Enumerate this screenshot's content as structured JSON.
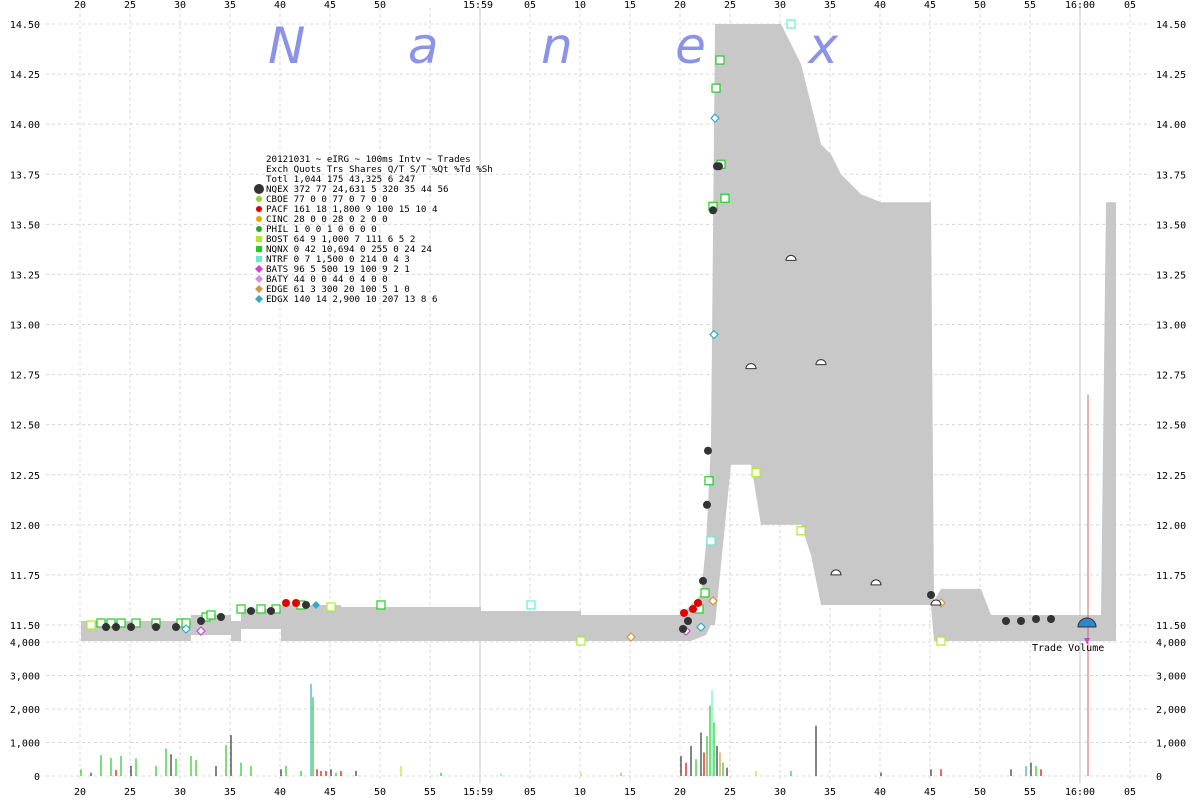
{
  "watermark": "N a n e x",
  "legend": {
    "title": "20121031 ~ eIRG ~ 100ms Intv ~ Trades",
    "header": "Exch Quots Trs Shares  Q/T   S/T  %Qt %Td %Sh",
    "total": "Totl 1,044 175 43,325   6   247",
    "rows": [
      {
        "ex": "NQEX",
        "text": "NQEX   372  77 24,631   5   320  35  44  56",
        "color": "#333333",
        "shape": "circle",
        "big": true
      },
      {
        "ex": "CBOE",
        "text": "CBOE    77   0      0  77     0   7   0   0",
        "color": "#9acd32",
        "shape": "circle"
      },
      {
        "ex": "PACF",
        "text": "PACF   161  18  1,800   9   100  15  10   4",
        "color": "#e00000",
        "shape": "circle"
      },
      {
        "ex": "CINC",
        "text": "CINC    28   0      0  28     0   2   0   0",
        "color": "#f0a000",
        "shape": "circle"
      },
      {
        "ex": "PHIL",
        "text": "PHIL     1   0      0   1     0   0   0   0",
        "color": "#22aa22",
        "shape": "circle"
      },
      {
        "ex": "BOST",
        "text": "BOST    64   9  1,000   7   111   6   5   2",
        "color": "#aaee22",
        "shape": "square"
      },
      {
        "ex": "NQNX",
        "text": "NQNX     0  42 10,694   0   255   0  24  24",
        "color": "#22cc22",
        "shape": "square"
      },
      {
        "ex": "NTRF",
        "text": "NTRF     0   7  1,500   0   214   0   4   3",
        "color": "#66eecc",
        "shape": "square"
      },
      {
        "ex": "BATS",
        "text": "BATS    96   5    500  19   100   9   2   1",
        "color": "#cc44cc",
        "shape": "diamond"
      },
      {
        "ex": "BATY",
        "text": "BATY    44   0      0  44     0   4   0   0",
        "color": "#dd88ee",
        "shape": "diamond"
      },
      {
        "ex": "EDGE",
        "text": "EDGE    61   3    300  20   100   5   1   0",
        "color": "#cc9944",
        "shape": "diamond"
      },
      {
        "ex": "EDGX",
        "text": "EDGX   140  14  2,900  10   207  13   8   6",
        "color": "#33aacc",
        "shape": "diamond"
      }
    ]
  },
  "annotation": "Trade Volume",
  "chart_data": {
    "type": "line",
    "x_ticks_top": [
      "20",
      "25",
      "30",
      "35",
      "40",
      "45",
      "50",
      "15:59",
      "05",
      "10",
      "15",
      "20",
      "25",
      "30",
      "35",
      "40",
      "45",
      "50",
      "55",
      "16:00",
      "05"
    ],
    "x_ticks_bottom": [
      "20",
      "25",
      "30",
      "35",
      "40",
      "45",
      "50",
      "55",
      "15:59",
      "05",
      "10",
      "15",
      "20",
      "25",
      "30",
      "35",
      "40",
      "45",
      "50",
      "55",
      "16:00",
      "05"
    ],
    "price_ticks": [
      "14.50",
      "14.25",
      "14.00",
      "13.75",
      "13.50",
      "13.25",
      "13.00",
      "12.75",
      "12.50",
      "12.25",
      "12.00",
      "11.75",
      "11.50"
    ],
    "volume_ticks_right": [
      "4,000",
      "3,000",
      "2,000",
      "1,000",
      "0"
    ],
    "volume_ticks_left": [
      "4,000",
      "3,000",
      "2,000",
      "1,000",
      "0"
    ],
    "price_ylim": [
      11.5,
      14.5
    ],
    "volume_ylim": [
      0,
      4000
    ],
    "x_range_seconds": [
      -40,
      65
    ],
    "nbbo_band": [
      {
        "t": -40,
        "lo": 11.42,
        "hi": 11.52
      },
      {
        "t": -29,
        "lo": 11.42,
        "hi": 11.52
      },
      {
        "t": -29,
        "lo": 11.45,
        "hi": 11.55
      },
      {
        "t": -25,
        "lo": 11.45,
        "hi": 11.55
      },
      {
        "t": -25,
        "lo": 11.42,
        "hi": 11.52
      },
      {
        "t": -24,
        "lo": 11.42,
        "hi": 11.52
      },
      {
        "t": -24,
        "lo": 11.48,
        "hi": 11.58
      },
      {
        "t": -20,
        "lo": 11.48,
        "hi": 11.58
      },
      {
        "t": -20,
        "lo": 11.42,
        "hi": 11.6
      },
      {
        "t": -14,
        "lo": 11.42,
        "hi": 11.6
      },
      {
        "t": -14,
        "lo": 11.42,
        "hi": 11.59
      },
      {
        "t": 0,
        "lo": 11.42,
        "hi": 11.59
      },
      {
        "t": 0,
        "lo": 11.42,
        "hi": 11.57
      },
      {
        "t": 10,
        "lo": 11.42,
        "hi": 11.57
      },
      {
        "t": 10,
        "lo": 11.42,
        "hi": 11.55
      },
      {
        "t": 20,
        "lo": 11.42,
        "hi": 11.55
      },
      {
        "t": 21,
        "lo": 11.42,
        "hi": 11.6
      },
      {
        "t": 22,
        "lo": 11.44,
        "hi": 11.65
      },
      {
        "t": 22.5,
        "lo": 11.45,
        "hi": 11.9
      },
      {
        "t": 23,
        "lo": 11.5,
        "hi": 12.4
      },
      {
        "t": 23.4,
        "lo": 11.5,
        "hi": 14.5
      },
      {
        "t": 24,
        "lo": 11.8,
        "hi": 14.5
      },
      {
        "t": 25,
        "lo": 12.3,
        "hi": 14.5
      },
      {
        "t": 27,
        "lo": 12.3,
        "hi": 14.5
      },
      {
        "t": 28,
        "lo": 12.0,
        "hi": 14.5
      },
      {
        "t": 30,
        "lo": 12.0,
        "hi": 14.5
      },
      {
        "t": 31,
        "lo": 12.0,
        "hi": 14.4
      },
      {
        "t": 32,
        "lo": 12.0,
        "hi": 14.3
      },
      {
        "t": 33,
        "lo": 11.85,
        "hi": 14.1
      },
      {
        "t": 34,
        "lo": 11.6,
        "hi": 13.9
      },
      {
        "t": 35,
        "lo": 11.6,
        "hi": 13.85
      },
      {
        "t": 36,
        "lo": 11.6,
        "hi": 13.75
      },
      {
        "t": 37,
        "lo": 11.6,
        "hi": 13.7
      },
      {
        "t": 38,
        "lo": 11.6,
        "hi": 13.65
      },
      {
        "t": 40,
        "lo": 11.6,
        "hi": 13.61
      },
      {
        "t": 45,
        "lo": 11.6,
        "hi": 13.61
      },
      {
        "t": 45.3,
        "lo": 11.42,
        "hi": 11.62
      },
      {
        "t": 46,
        "lo": 11.42,
        "hi": 11.68
      },
      {
        "t": 50,
        "lo": 11.42,
        "hi": 11.68
      },
      {
        "t": 51,
        "lo": 11.42,
        "hi": 11.55
      },
      {
        "t": 57,
        "lo": 11.42,
        "hi": 11.55
      },
      {
        "t": 59,
        "lo": 11.42,
        "hi": 11.55
      },
      {
        "t": 62,
        "lo": 11.42,
        "hi": 11.55
      },
      {
        "t": 62.5,
        "lo": 11.42,
        "hi": 13.61
      },
      {
        "t": 63.5,
        "lo": 11.42,
        "hi": 13.61
      }
    ],
    "trades": [
      {
        "t": -37.5,
        "p": 11.49,
        "ex": "NQEX"
      },
      {
        "t": -36.5,
        "p": 11.49,
        "ex": "NQEX"
      },
      {
        "t": -35,
        "p": 11.49,
        "ex": "NQEX"
      },
      {
        "t": -32.5,
        "p": 11.49,
        "ex": "NQEX"
      },
      {
        "t": -30.5,
        "p": 11.49,
        "ex": "NQEX"
      },
      {
        "t": -28,
        "p": 11.52,
        "ex": "NQEX"
      },
      {
        "t": -26,
        "p": 11.54,
        "ex": "NQEX"
      },
      {
        "t": -23,
        "p": 11.57,
        "ex": "NQEX"
      },
      {
        "t": -21,
        "p": 11.57,
        "ex": "NQEX"
      },
      {
        "t": -19.5,
        "p": 11.61,
        "ex": "PACF"
      },
      {
        "t": -18.5,
        "p": 11.61,
        "ex": "PACF"
      },
      {
        "t": -17.5,
        "p": 11.6,
        "ex": "NQEX"
      },
      {
        "t": -16.5,
        "p": 11.6,
        "ex": "EDGX"
      },
      {
        "t": 20.2,
        "p": 11.48,
        "ex": "NQEX"
      },
      {
        "t": 20.7,
        "p": 11.52,
        "ex": "NQEX"
      },
      {
        "t": 20.3,
        "p": 11.56,
        "ex": "PACF"
      },
      {
        "t": 21.2,
        "p": 11.58,
        "ex": "PACF"
      },
      {
        "t": 21.7,
        "p": 11.61,
        "ex": "PACF"
      },
      {
        "t": 22.2,
        "p": 11.72,
        "ex": "NQEX"
      },
      {
        "t": 22.6,
        "p": 12.1,
        "ex": "NQEX"
      },
      {
        "t": 22.7,
        "p": 12.37,
        "ex": "NQEX"
      },
      {
        "t": 23.6,
        "p": 13.79,
        "ex": "NQEX"
      },
      {
        "t": 23.8,
        "p": 13.79,
        "ex": "NQEX"
      },
      {
        "t": 23.2,
        "p": 13.57,
        "ex": "NQEX"
      },
      {
        "t": 45,
        "p": 11.65,
        "ex": "NQEX"
      },
      {
        "t": 52.5,
        "p": 11.52,
        "ex": "NQEX"
      },
      {
        "t": 54,
        "p": 11.52,
        "ex": "NQEX"
      },
      {
        "t": 55.5,
        "p": 11.53,
        "ex": "NQEX"
      },
      {
        "t": 57,
        "p": 11.53,
        "ex": "NQEX"
      }
    ],
    "quotes": [
      {
        "t": -39,
        "p": 11.5,
        "ex": "BOST"
      },
      {
        "t": -38,
        "p": 11.51,
        "ex": "NQNX"
      },
      {
        "t": -37,
        "p": 11.51,
        "ex": "NQNX"
      },
      {
        "t": -36,
        "p": 11.51,
        "ex": "NQNX"
      },
      {
        "t": -34.5,
        "p": 11.51,
        "ex": "NQNX"
      },
      {
        "t": -32.5,
        "p": 11.51,
        "ex": "NQNX"
      },
      {
        "t": -30,
        "p": 11.51,
        "ex": "NQNX"
      },
      {
        "t": -29.5,
        "p": 11.51,
        "ex": "NQNX"
      },
      {
        "t": -27.5,
        "p": 11.54,
        "ex": "NQNX"
      },
      {
        "t": -27,
        "p": 11.55,
        "ex": "NQNX"
      },
      {
        "t": -24,
        "p": 11.58,
        "ex": "NQNX"
      },
      {
        "t": -22,
        "p": 11.58,
        "ex": "NQNX"
      },
      {
        "t": -20.5,
        "p": 11.58,
        "ex": "NQNX"
      },
      {
        "t": -18,
        "p": 11.6,
        "ex": "NQNX"
      },
      {
        "t": -15,
        "p": 11.59,
        "ex": "BOST"
      },
      {
        "t": -10,
        "p": 11.6,
        "ex": "NQNX"
      },
      {
        "t": 5,
        "p": 11.6,
        "ex": "NTRF"
      },
      {
        "t": 21.8,
        "p": 11.58,
        "ex": "NQNX"
      },
      {
        "t": 22.4,
        "p": 11.66,
        "ex": "NQNX"
      },
      {
        "t": 22.8,
        "p": 12.22,
        "ex": "NQNX"
      },
      {
        "t": 23.0,
        "p": 11.92,
        "ex": "NTRF"
      },
      {
        "t": 23.2,
        "p": 13.59,
        "ex": "NQNX"
      },
      {
        "t": 23.5,
        "p": 14.18,
        "ex": "NQNX"
      },
      {
        "t": 23.9,
        "p": 14.32,
        "ex": "NQNX"
      },
      {
        "t": 24.0,
        "p": 13.8,
        "ex": "NQNX"
      },
      {
        "t": 24.4,
        "p": 13.63,
        "ex": "NQNX"
      },
      {
        "t": 27.5,
        "p": 12.26,
        "ex": "BOST"
      },
      {
        "t": 31,
        "p": 14.5,
        "ex": "NTRF"
      },
      {
        "t": 32,
        "p": 11.97,
        "ex": "BOST"
      },
      {
        "t": 46,
        "p": 11.42,
        "ex": "BOST"
      },
      {
        "t": 10,
        "p": 11.42,
        "ex": "BOST"
      },
      {
        "t": 15,
        "p": 11.44,
        "ex": "EDGE"
      },
      {
        "t": 20.5,
        "p": 11.47,
        "ex": "BATS"
      },
      {
        "t": 22,
        "p": 11.49,
        "ex": "EDGX"
      },
      {
        "t": 23.2,
        "p": 11.62,
        "ex": "EDGE"
      },
      {
        "t": 23.3,
        "p": 12.95,
        "ex": "EDGX"
      },
      {
        "t": 23.4,
        "p": 14.03,
        "ex": "EDGX"
      },
      {
        "t": -29.5,
        "p": 11.48,
        "ex": "EDGX"
      },
      {
        "t": -28,
        "p": 11.47,
        "ex": "BATS"
      },
      {
        "t": 46,
        "p": 11.61,
        "ex": "EDGE"
      }
    ],
    "half_markers": [
      {
        "t": 27,
        "p": 12.78
      },
      {
        "t": 31,
        "p": 13.32
      },
      {
        "t": 34,
        "p": 12.8
      },
      {
        "t": 35.5,
        "p": 11.75
      },
      {
        "t": 39.5,
        "p": 11.7
      },
      {
        "t": 45.5,
        "p": 11.6
      }
    ],
    "volume_bars": [
      {
        "t": -40,
        "v": 200,
        "c": "#22cc22"
      },
      {
        "t": -39,
        "v": 100,
        "c": "#333333"
      },
      {
        "t": -38,
        "v": 620,
        "c": "#22cc22"
      },
      {
        "t": -37,
        "v": 540,
        "c": "#22cc22"
      },
      {
        "t": -36.5,
        "v": 180,
        "c": "#e00000"
      },
      {
        "t": -36,
        "v": 600,
        "c": "#22cc22"
      },
      {
        "t": -35,
        "v": 300,
        "c": "#333333"
      },
      {
        "t": -34.5,
        "v": 520,
        "c": "#22cc22"
      },
      {
        "t": -32.5,
        "v": 300,
        "c": "#22cc22"
      },
      {
        "t": -31.5,
        "v": 820,
        "c": "#22cc22"
      },
      {
        "t": -31,
        "v": 650,
        "c": "#333333"
      },
      {
        "t": -30.5,
        "v": 520,
        "c": "#22cc22"
      },
      {
        "t": -29,
        "v": 600,
        "c": "#22cc22"
      },
      {
        "t": -28.5,
        "v": 480,
        "c": "#22cc22"
      },
      {
        "t": -26.5,
        "v": 300,
        "c": "#333333"
      },
      {
        "t": -25.5,
        "v": 920,
        "c": "#22cc22"
      },
      {
        "t": -25,
        "v": 1220,
        "c": "#333333"
      },
      {
        "t": -24,
        "v": 400,
        "c": "#22cc22"
      },
      {
        "t": -23,
        "v": 300,
        "c": "#22cc22"
      },
      {
        "t": -20,
        "v": 200,
        "c": "#333333"
      },
      {
        "t": -19.5,
        "v": 300,
        "c": "#22cc22"
      },
      {
        "t": -18,
        "v": 150,
        "c": "#22cc22"
      },
      {
        "t": -17,
        "v": 2750,
        "c": "#33aacc"
      },
      {
        "t": -16.8,
        "v": 2350,
        "c": "#22cc22"
      },
      {
        "t": -16.4,
        "v": 200,
        "c": "#e00000"
      },
      {
        "t": -16,
        "v": 150,
        "c": "#e00000"
      },
      {
        "t": -15.5,
        "v": 150,
        "c": "#e00000"
      },
      {
        "t": -15,
        "v": 200,
        "c": "#333333"
      },
      {
        "t": -14.5,
        "v": 100,
        "c": "#22cc22"
      },
      {
        "t": -14,
        "v": 150,
        "c": "#e00000"
      },
      {
        "t": -12.5,
        "v": 150,
        "c": "#333333"
      },
      {
        "t": -8,
        "v": 300,
        "c": "#aaee22"
      },
      {
        "t": -4,
        "v": 100,
        "c": "#22cc22"
      },
      {
        "t": 2,
        "v": 80,
        "c": "#66eecc"
      },
      {
        "t": 10,
        "v": 100,
        "c": "#aaee22"
      },
      {
        "t": 14,
        "v": 100,
        "c": "#cc9944"
      },
      {
        "t": 20,
        "v": 600,
        "c": "#333333"
      },
      {
        "t": 20.5,
        "v": 400,
        "c": "#e00000"
      },
      {
        "t": 21,
        "v": 900,
        "c": "#333333"
      },
      {
        "t": 21.5,
        "v": 500,
        "c": "#22cc22"
      },
      {
        "t": 22,
        "v": 1300,
        "c": "#333333"
      },
      {
        "t": 22.3,
        "v": 700,
        "c": "#e00000"
      },
      {
        "t": 22.6,
        "v": 1200,
        "c": "#22cc22"
      },
      {
        "t": 22.9,
        "v": 2100,
        "c": "#22cc22"
      },
      {
        "t": 23.1,
        "v": 2550,
        "c": "#66eecc"
      },
      {
        "t": 23.3,
        "v": 1600,
        "c": "#22cc22"
      },
      {
        "t": 23.6,
        "v": 900,
        "c": "#333333"
      },
      {
        "t": 23.9,
        "v": 700,
        "c": "#cc9944"
      },
      {
        "t": 24.2,
        "v": 400,
        "c": "#22cc22"
      },
      {
        "t": 24.6,
        "v": 250,
        "c": "#333333"
      },
      {
        "t": 27.5,
        "v": 150,
        "c": "#aaee22"
      },
      {
        "t": 31,
        "v": 150,
        "c": "#33aacc"
      },
      {
        "t": 33.5,
        "v": 1500,
        "c": "#333333"
      },
      {
        "t": 40,
        "v": 100,
        "c": "#333333"
      },
      {
        "t": 45,
        "v": 200,
        "c": "#333333"
      },
      {
        "t": 46,
        "v": 200,
        "c": "#e00000"
      },
      {
        "t": 53,
        "v": 200,
        "c": "#333333"
      },
      {
        "t": 54.5,
        "v": 300,
        "c": "#33aacc"
      },
      {
        "t": 55,
        "v": 400,
        "c": "#333333"
      },
      {
        "t": 55.5,
        "v": 300,
        "c": "#22cc22"
      },
      {
        "t": 56,
        "v": 200,
        "c": "#e00000"
      }
    ],
    "closing_cross": {
      "t": 60.6,
      "p": 11.49,
      "volume_spike": 4000,
      "spike_top_price": 12.65
    }
  }
}
